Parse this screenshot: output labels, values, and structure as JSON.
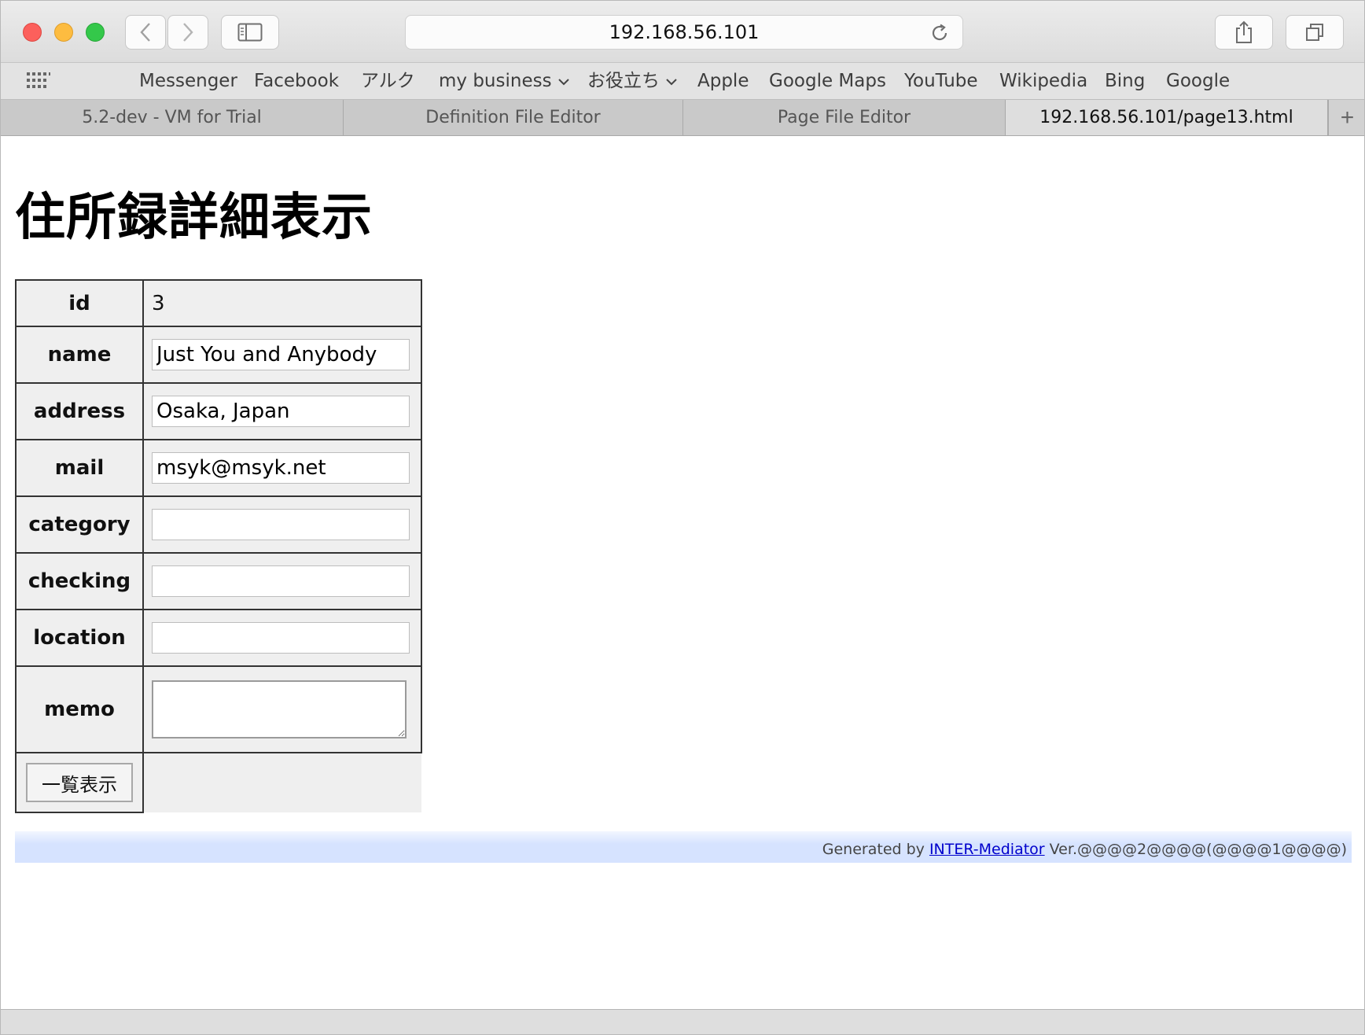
{
  "browser": {
    "url": "192.168.56.101",
    "favorites": [
      {
        "label": "Messenger",
        "has_menu": false
      },
      {
        "label": "Facebook",
        "has_menu": false
      },
      {
        "label": "アルク",
        "has_menu": false
      },
      {
        "label": "my business",
        "has_menu": true
      },
      {
        "label": "お役立ち",
        "has_menu": true
      },
      {
        "label": "Apple",
        "has_menu": false
      },
      {
        "label": "Google Maps",
        "has_menu": false
      },
      {
        "label": "YouTube",
        "has_menu": false
      },
      {
        "label": "Wikipedia",
        "has_menu": false
      },
      {
        "label": "Bing",
        "has_menu": false
      },
      {
        "label": "Google",
        "has_menu": false
      }
    ],
    "tabs": [
      {
        "label": "5.2-dev - VM for Trial",
        "active": false
      },
      {
        "label": "Definition File Editor",
        "active": false
      },
      {
        "label": "Page File Editor",
        "active": false
      },
      {
        "label": "192.168.56.101/page13.html",
        "active": true
      }
    ],
    "new_tab_symbol": "+"
  },
  "page": {
    "title": "住所録詳細表示",
    "rows": {
      "id": {
        "label": "id",
        "value": "3"
      },
      "name": {
        "label": "name",
        "value": "Just You and Anybody"
      },
      "address": {
        "label": "address",
        "value": "Osaka, Japan"
      },
      "mail": {
        "label": "mail",
        "value": "msyk@msyk.net"
      },
      "category": {
        "label": "category",
        "value": ""
      },
      "checking": {
        "label": "checking",
        "value": ""
      },
      "location": {
        "label": "location",
        "value": ""
      },
      "memo": {
        "label": "memo",
        "value": ""
      }
    },
    "list_button_label": "一覧表示",
    "footer": {
      "prefix": "Generated by ",
      "link_text": "INTER-Mediator",
      "suffix": " Ver.@@@@2@@@@(@@@@1@@@@)"
    }
  },
  "colors": {
    "footer_band": "#d6e3ff",
    "table_bg": "#efefef",
    "link": "#0000cc"
  }
}
